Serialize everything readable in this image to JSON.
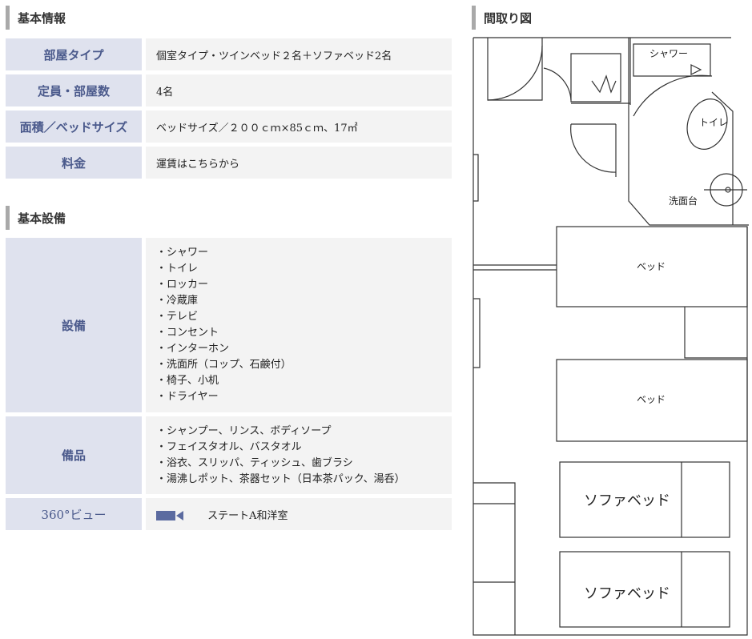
{
  "basic_info": {
    "heading": "基本情報",
    "rows": [
      {
        "label": "部屋タイプ",
        "value": "個室タイプ・ツインベッド２名＋ソファベッド2名"
      },
      {
        "label": "定員・部屋数",
        "value": "4名"
      },
      {
        "label": "面積／ベッドサイズ",
        "value": "ベッドサイズ／２００ｃｍ×85ｃｍ、17㎡"
      },
      {
        "label": "料金",
        "value": "運賃はこちらから"
      }
    ]
  },
  "facilities": {
    "heading": "基本設備",
    "equipment": {
      "label": "設備",
      "items": [
        "・シャワー",
        "・トイレ",
        "・ロッカー",
        "・冷蔵庫",
        "・テレビ",
        "・コンセント",
        "・インターホン",
        "・洗面所（コップ、石鹸付）",
        "・椅子、小机",
        "・ドライヤー"
      ]
    },
    "amenities": {
      "label": "備品",
      "items": [
        "・シャンプー、リンス、ボディソープ",
        "・フェイスタオル、バスタオル",
        "・浴衣、スリッパ、ティッシュ、歯ブラシ",
        "・湯沸しポット、茶器セット（日本茶パック、湯呑）"
      ]
    },
    "view360": {
      "label": "360°ビュー",
      "link_text": "ステートA和洋室",
      "icon": "video-camera-icon"
    }
  },
  "floorplan": {
    "heading": "間取り図",
    "labels": {
      "shower": "シャワー",
      "toilet": "トイレ",
      "sink": "洗面台",
      "bed1": "ベッド",
      "bed2": "ベッド",
      "sofa1": "ソファベッド",
      "sofa2": "ソファベッド"
    }
  },
  "colors": {
    "header_bg": "#dfe2ee",
    "header_text": "#4b5a8c",
    "cell_bg": "#f3f3f3",
    "heading_bar": "#a9a9a9",
    "icon": "#5b6ba0"
  }
}
